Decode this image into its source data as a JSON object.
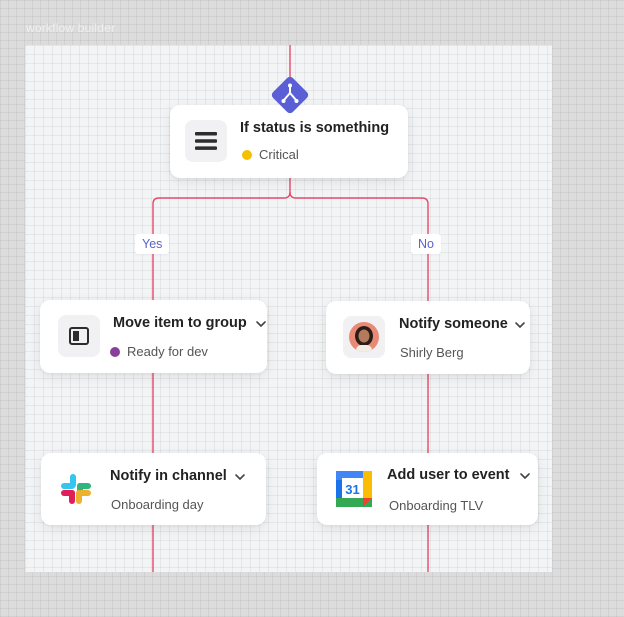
{
  "app": {
    "title": "workflow builder"
  },
  "theme": {
    "connector_color": "#e64a6b",
    "accent": "#5b5fd6",
    "branch_text": "#5a63c8"
  },
  "decision_node": {
    "icon": "branch-icon",
    "title": "If status is something",
    "status": {
      "label": "Critical",
      "color": "#f5c000"
    }
  },
  "branches": {
    "yes_label": "Yes",
    "no_label": "No"
  },
  "nodes": {
    "move_item": {
      "icon": "board-layout-icon",
      "title": "Move item to group",
      "status": {
        "label": "Ready for dev",
        "color": "#8a3e9c"
      }
    },
    "notify_someone": {
      "icon": "avatar",
      "title": "Notify someone",
      "subtitle": "Shirly Berg"
    },
    "notify_channel": {
      "icon": "slack-icon",
      "title": "Notify in channel",
      "subtitle": "Onboarding day"
    },
    "add_user_event": {
      "icon": "google-calendar-icon",
      "title": "Add user to event",
      "subtitle": "Onboarding TLV",
      "calendar_day": "31"
    }
  }
}
